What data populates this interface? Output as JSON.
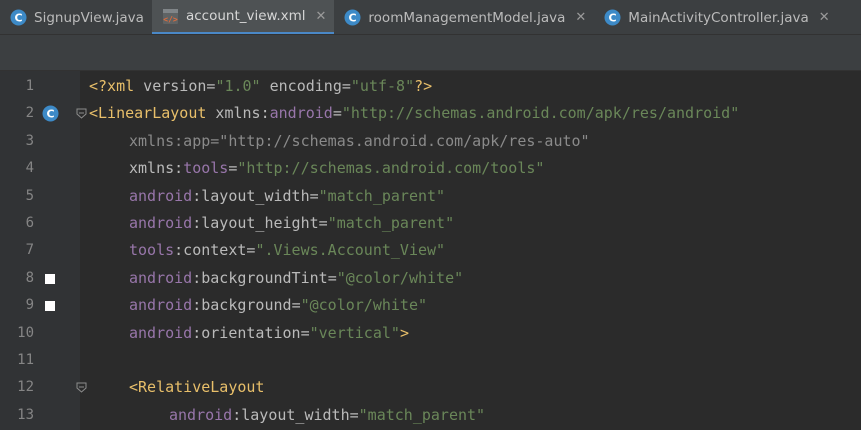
{
  "tabs": [
    {
      "label": "SignupView.java",
      "icon": "java-class-icon",
      "active": false
    },
    {
      "label": "account_view.xml",
      "icon": "xml-layout-icon",
      "active": true
    },
    {
      "label": "roomManagementModel.java",
      "icon": "java-class-icon",
      "active": false
    },
    {
      "label": "MainActivityController.java",
      "icon": "java-class-icon",
      "active": false
    }
  ],
  "colors": {
    "accent": "#4a88c7",
    "tag": "#e8bf6a",
    "namespace": "#9876aa",
    "string": "#6a8759",
    "text": "#a9b7c6"
  },
  "code": {
    "l1": {
      "num": "1",
      "a": "<?xml",
      "b": " version=",
      "c": "\"1.0\"",
      "d": " encoding=",
      "e": "\"utf-8\"",
      "f": "?>"
    },
    "l2": {
      "num": "2",
      "tag": "<LinearLayout",
      "attr": " xmlns:",
      "ns": "android",
      "eq": "=",
      "val": "\"http://schemas.android.com/apk/res/android\""
    },
    "l3": {
      "num": "3",
      "text": "xmlns:app=\"http://schemas.android.com/apk/res-auto\""
    },
    "l4": {
      "num": "4",
      "attr": "xmlns:",
      "ns": "tools",
      "eq": "=",
      "val": "\"http://schemas.android.com/tools\""
    },
    "l5": {
      "num": "5",
      "ns": "android",
      "attr": ":layout_width",
      "eq": "=",
      "val": "\"match_parent\""
    },
    "l6": {
      "num": "6",
      "ns": "android",
      "attr": ":layout_height",
      "eq": "=",
      "val": "\"match_parent\""
    },
    "l7": {
      "num": "7",
      "ns": "tools",
      "attr": ":context",
      "eq": "=",
      "val": "\".Views.Account_View\""
    },
    "l8": {
      "num": "8",
      "ns": "android",
      "attr": ":backgroundTint",
      "eq": "=",
      "val": "\"@color/white\""
    },
    "l9": {
      "num": "9",
      "ns": "android",
      "attr": ":background",
      "eq": "=",
      "val": "\"@color/white\""
    },
    "l10": {
      "num": "10",
      "ns": "android",
      "attr": ":orientation",
      "eq": "=",
      "val": "\"vertical\"",
      "close": ">"
    },
    "l11": {
      "num": "11"
    },
    "l12": {
      "num": "12",
      "tag": "<RelativeLayout"
    },
    "l13": {
      "num": "13",
      "ns": "android",
      "attr": ":layout_width",
      "eq": "=",
      "val": "\"match_parent\""
    }
  }
}
